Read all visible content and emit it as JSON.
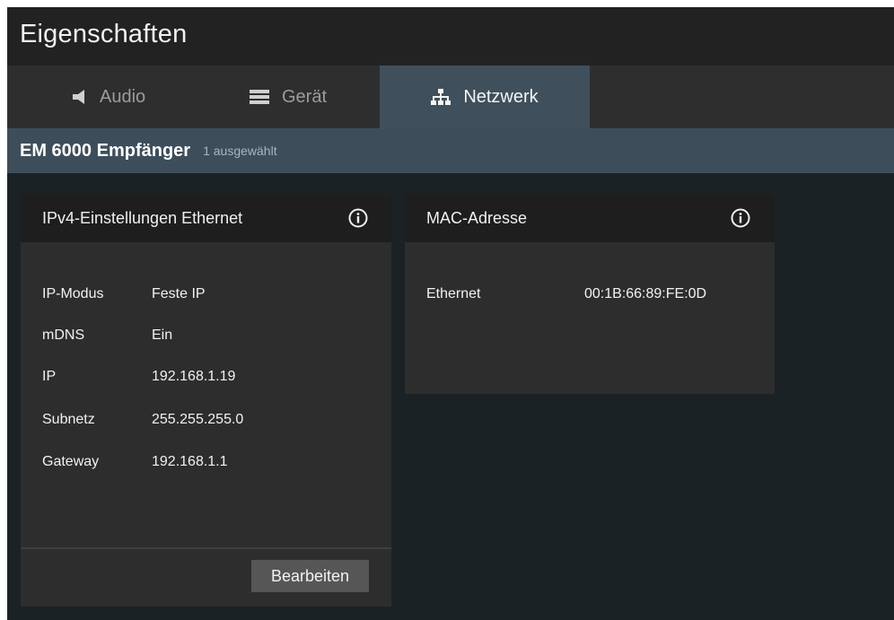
{
  "window": {
    "title": "Eigenschaften"
  },
  "tabs": [
    {
      "label": "Audio",
      "icon": "speaker-icon",
      "active": false
    },
    {
      "label": "Gerät",
      "icon": "device-icon",
      "active": false
    },
    {
      "label": "Netzwerk",
      "icon": "network-icon",
      "active": true
    }
  ],
  "subheader": {
    "device": "EM 6000 Empfänger",
    "selection": "1 ausgewählt"
  },
  "ipv4_card": {
    "title": "IPv4-Einstellungen Ethernet",
    "info_icon": "info-icon",
    "rows": [
      {
        "key": "IP-Modus",
        "value": "Feste IP"
      },
      {
        "key": "mDNS",
        "value": "Ein"
      },
      {
        "key": "IP",
        "value": "192.168.1.19"
      },
      {
        "key": "Subnetz",
        "value": "255.255.255.0"
      },
      {
        "key": "Gateway",
        "value": "192.168.1.1"
      }
    ],
    "edit_button": "Bearbeiten"
  },
  "mac_card": {
    "title": "MAC-Adresse",
    "info_icon": "info-icon",
    "rows": [
      {
        "key": "Ethernet",
        "value": "00:1B:66:89:FE:0D"
      }
    ]
  },
  "colors": {
    "active_tab": "#3f505c",
    "subheader": "#3d4e5a",
    "background": "#1b2225",
    "card": "#2d2d2e"
  }
}
